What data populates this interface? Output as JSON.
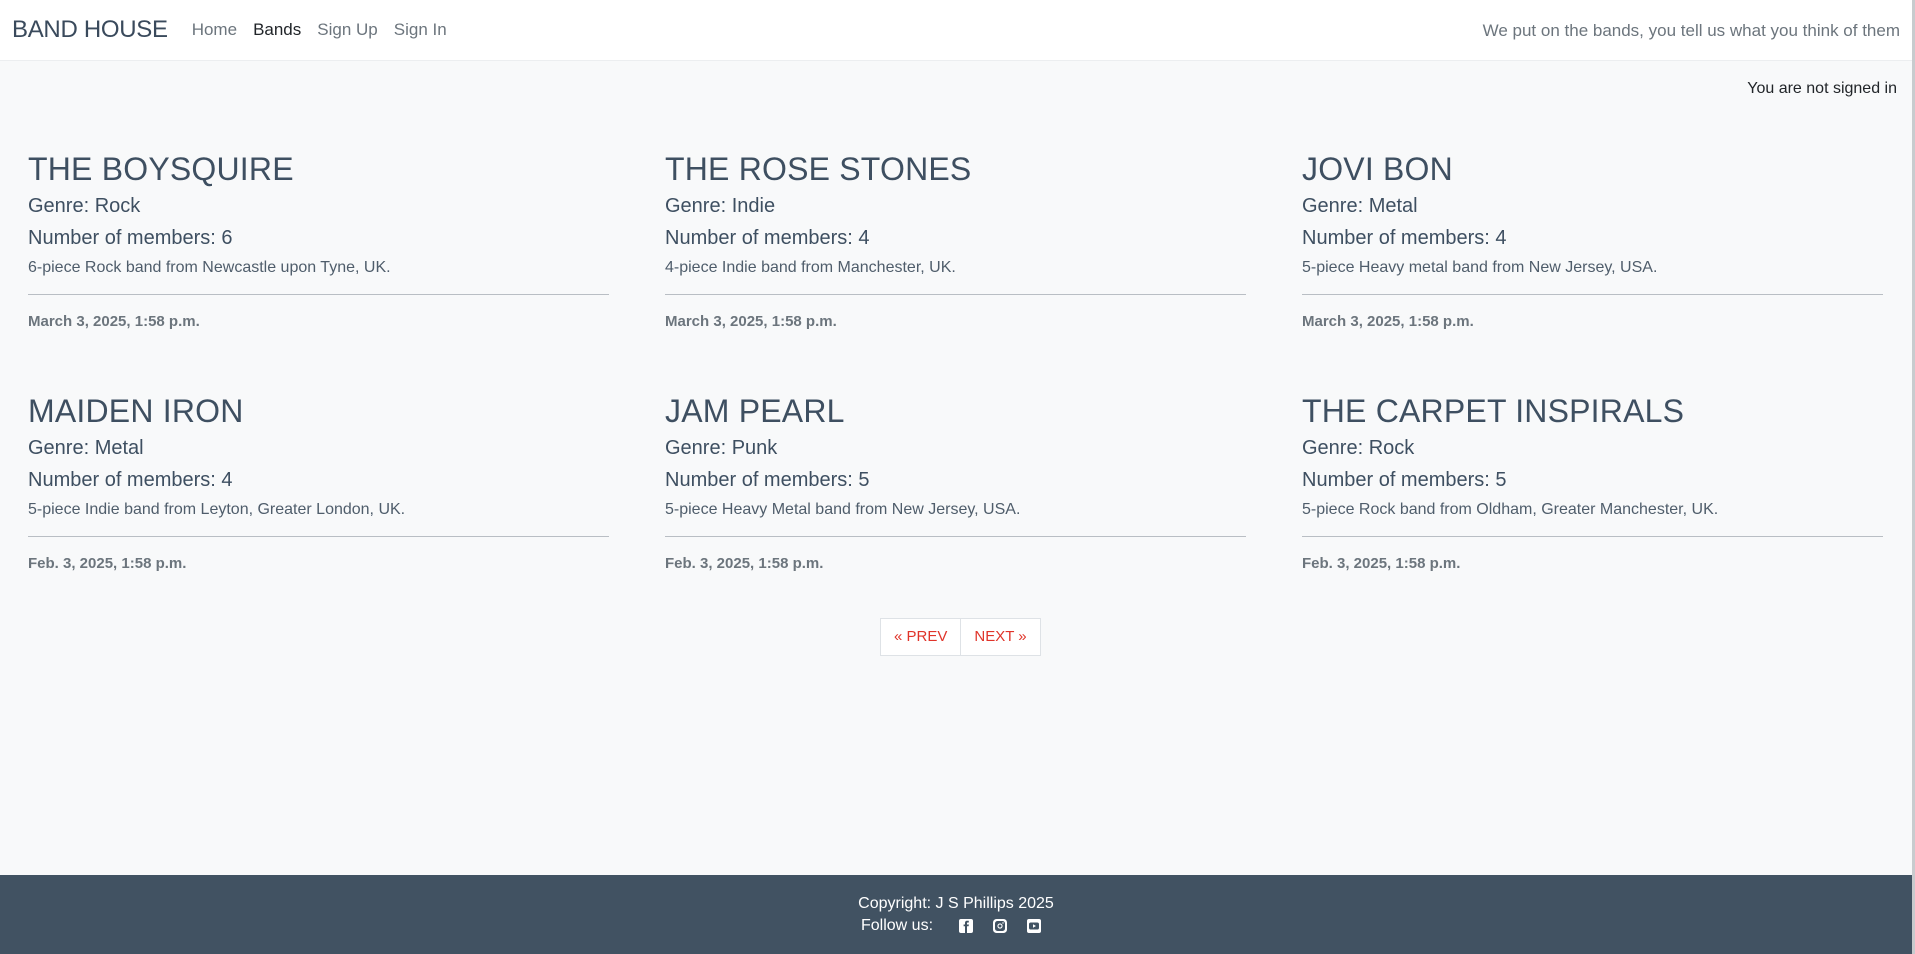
{
  "nav": {
    "brand": "BAND HOUSE",
    "links": [
      {
        "label": "Home"
      },
      {
        "label": "Bands"
      },
      {
        "label": "Sign Up"
      },
      {
        "label": "Sign In"
      }
    ],
    "tagline": "We put on the bands, you tell us what you think of them"
  },
  "status": {
    "signin": "You are not signed in"
  },
  "bands": [
    {
      "name": "THE BOYSQUIRE",
      "genre": "Genre: Rock",
      "members": "Number of members: 6",
      "description": "6-piece Rock band from Newcastle upon Tyne, UK.",
      "date": "March 3, 2025, 1:58 p.m."
    },
    {
      "name": "THE ROSE STONES",
      "genre": "Genre: Indie",
      "members": "Number of members: 4",
      "description": "4-piece Indie band from Manchester, UK.",
      "date": "March 3, 2025, 1:58 p.m."
    },
    {
      "name": "JOVI BON",
      "genre": "Genre: Metal",
      "members": "Number of members: 4",
      "description": "5-piece Heavy metal band from New Jersey, USA.",
      "date": "March 3, 2025, 1:58 p.m."
    },
    {
      "name": "MAIDEN IRON",
      "genre": "Genre: Metal",
      "members": "Number of members: 4",
      "description": "5-piece Indie band from Leyton, Greater London, UK.",
      "date": "Feb. 3, 2025, 1:58 p.m."
    },
    {
      "name": "JAM PEARL",
      "genre": "Genre: Punk",
      "members": "Number of members: 5",
      "description": "5-piece Heavy Metal band from New Jersey, USA.",
      "date": "Feb. 3, 2025, 1:58 p.m."
    },
    {
      "name": "THE CARPET INSPIRALS",
      "genre": "Genre: Rock",
      "members": "Number of members: 5",
      "description": "5-piece Rock band from Oldham, Greater Manchester, UK.",
      "date": "Feb. 3, 2025, 1:58 p.m."
    }
  ],
  "pagination": {
    "prev": "« PREV",
    "next": "NEXT »"
  },
  "footer": {
    "copyright": "Copyright: J S Phillips 2025",
    "follow_label": "Follow us:",
    "icons": [
      "facebook-icon",
      "instagram-icon",
      "youtube-icon"
    ]
  },
  "colors": {
    "accent": "#e0342a",
    "footer_bg": "#415262",
    "heading": "#3e4f61"
  }
}
